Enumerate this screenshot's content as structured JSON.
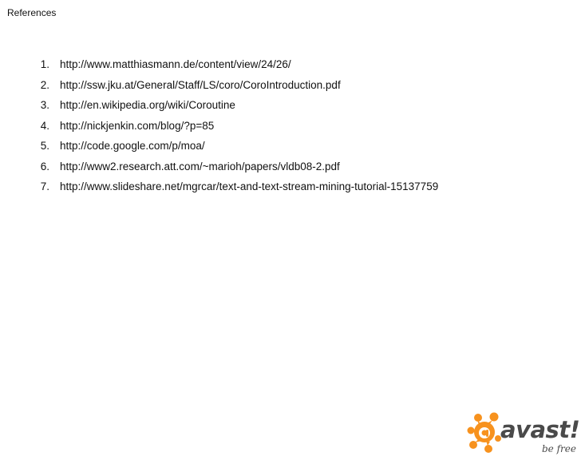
{
  "slide": {
    "title": "References"
  },
  "references": [
    {
      "number": "1.",
      "url": "http://www.matthiasmann.de/content/view/24/26/"
    },
    {
      "number": "2.",
      "url": "http://ssw.jku.at/General/Staff/LS/coro/CoroIntroduction.pdf"
    },
    {
      "number": "3.",
      "url": "http://en.wikipedia.org/wiki/Coroutine"
    },
    {
      "number": "4.",
      "url": "http://nickjenkin.com/blog/?p=85"
    },
    {
      "number": "5.",
      "url": "http://code.google.com/p/moa/"
    },
    {
      "number": "6.",
      "url": "http://www2.research.att.com/~marioh/papers/vldb08-2.pdf"
    },
    {
      "number": "7.",
      "url": "http://www.slideshare.net/mgrcar/text-and-text-stream-mining-tutorial-15137759"
    }
  ],
  "logo": {
    "brand": "avast!",
    "tagline": "be free",
    "colors": {
      "orange": "#f7921e",
      "text": "#4a4a4a",
      "white": "#ffffff"
    }
  }
}
